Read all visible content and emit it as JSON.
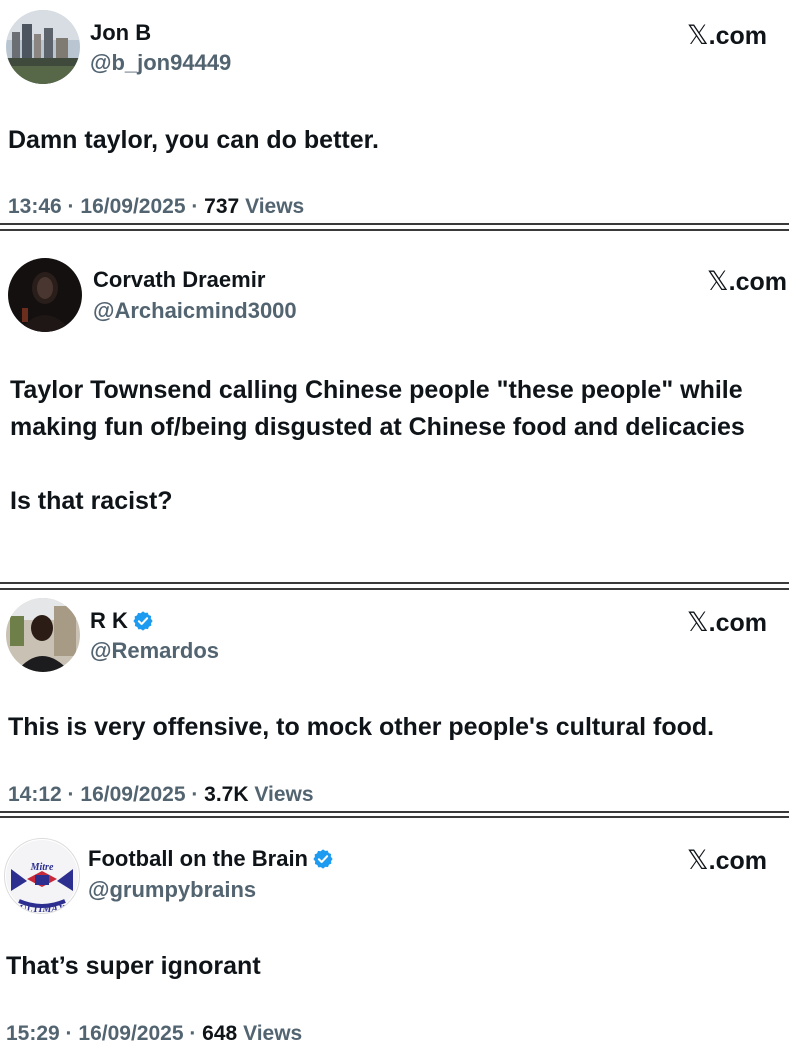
{
  "tweets": [
    {
      "name": "Jon B",
      "verified": false,
      "handle": "@b_jon94449",
      "source": ".com",
      "text": "Damn taylor, you can do better.",
      "time": "13:46",
      "date": "16/09/2025",
      "views": "737",
      "views_label": "Views"
    },
    {
      "name": "Corvath Draemir",
      "verified": false,
      "handle": "@Archaicmind3000",
      "source": ".com",
      "text": "Taylor Townsend calling Chinese people \"these people\" while making fun of/being disgusted at Chinese food and delicacies\n\nIs that racist?"
    },
    {
      "name": "R K",
      "verified": true,
      "handle": "@Remardos",
      "source": ".com",
      "text": "This is very offensive, to mock other people's cultural food.",
      "time": "14:12",
      "date": "16/09/2025",
      "views": "3.7K",
      "views_label": "Views"
    },
    {
      "name": "Football on the Brain",
      "verified": true,
      "handle": "@grumpybrains",
      "source": ".com",
      "avatar_text": "Mitre ULTIMAX",
      "text": "That’s super ignorant",
      "time": "15:29",
      "date": "16/09/2025",
      "views": "648",
      "views_label": "Views"
    }
  ],
  "meta_separator": " · ",
  "x_glyph": "𝕏",
  "colors": {
    "text_primary": "#0f1419",
    "text_secondary": "#536471",
    "verified_blue": "#1d9bf0",
    "divider": "#3a3a3a"
  },
  "icons": {
    "source_logo": "x-logo-icon",
    "verified": "verified-badge-icon"
  }
}
